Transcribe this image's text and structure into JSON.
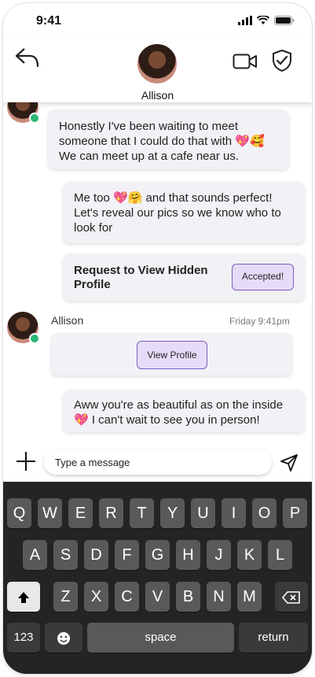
{
  "status_bar": {
    "time": "9:41"
  },
  "header": {
    "contact_name": "Allison"
  },
  "messages": [
    {
      "text": "Honestly I've been waiting to meet someone that I could do that with 💖🥰 We can meet up at a cafe near us."
    },
    {
      "text": "Me too 💖🤗  and that sounds perfect! Let's reveal our pics so we know who to look for"
    },
    {
      "text": "Request to View Hidden Profile",
      "button": "Accepted!"
    },
    {
      "sender": "Allison",
      "timestamp": "Friday 9:41pm",
      "button": "View Profile"
    },
    {
      "text": "Aww you're as beautiful as on the inside 💖 I can't wait to see you in person!"
    }
  ],
  "composer": {
    "placeholder": "Type a message"
  },
  "keyboard": {
    "row1": [
      "Q",
      "W",
      "E",
      "R",
      "T",
      "Y",
      "U",
      "I",
      "O",
      "P"
    ],
    "row2": [
      "A",
      "S",
      "D",
      "F",
      "G",
      "H",
      "J",
      "K",
      "L"
    ],
    "row3": [
      "Z",
      "X",
      "C",
      "V",
      "B",
      "N",
      "M"
    ],
    "numbers_key": "123",
    "space_key": "space",
    "return_key": "return"
  },
  "colors": {
    "accent": "#7b5ec3",
    "accent_bg": "#e7dcf8",
    "online": "#2bb673",
    "keyboard_bg": "#242425"
  }
}
